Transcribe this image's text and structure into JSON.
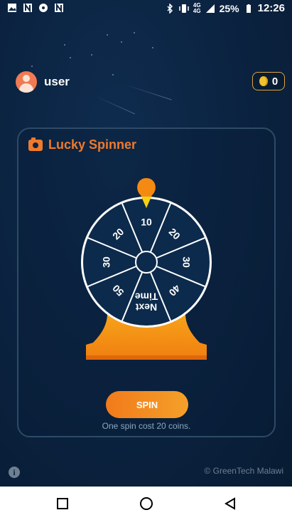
{
  "status_bar": {
    "battery": "25%",
    "time": "12:26",
    "network_top": "4G",
    "network_bottom": "4G",
    "icons": [
      "gallery-icon",
      "n-icon",
      "chat-icon",
      "n-icon",
      "bluetooth-icon",
      "vibrate-icon",
      "signal-icon",
      "battery-icon"
    ]
  },
  "user": {
    "name": "user"
  },
  "coins": {
    "count": "0",
    "color": "#f2c12e"
  },
  "card": {
    "title": "Lucky Spinner",
    "segments": [
      "10",
      "20",
      "30",
      "40",
      "Next Time",
      "50",
      "30",
      "20"
    ],
    "spin_label": "SPIN",
    "spin_cost": "One spin cost 20 coins."
  },
  "footer": {
    "copyright": "© GreenTech Malawi"
  },
  "colors": {
    "accent": "#f07a2b",
    "background": "#0b2442"
  }
}
